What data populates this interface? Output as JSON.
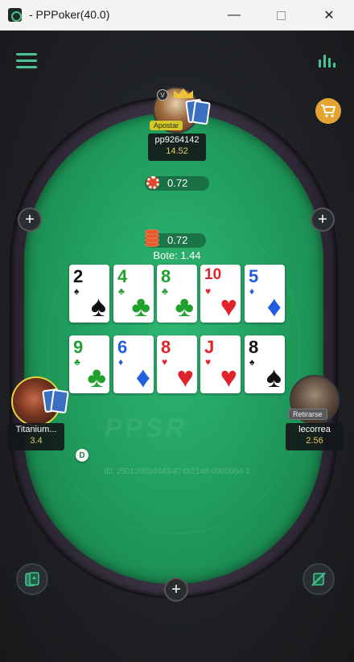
{
  "window": {
    "title": "- PPPoker(40.0)",
    "minimize": "—",
    "close": "✕"
  },
  "colors": {
    "accent": "#46c496",
    "felt": "#1f9a5b",
    "stack_text": "#e6c75c",
    "bet_tag": "#d6c829"
  },
  "toolbar": {
    "menu_icon": "hamburger-menu-icon",
    "stats_icon": "bar-chart-icon",
    "shop_icon": "shopping-cart-icon"
  },
  "players": {
    "top": {
      "name": "pp9264142",
      "stack": "14.52",
      "action": "Apostar",
      "bet": "0.72"
    },
    "left": {
      "name": "Titanium...",
      "stack": "3.4"
    },
    "right": {
      "name": "lecorrea",
      "stack": "2.56",
      "action": "Retirarse"
    }
  },
  "dealer_button": "D",
  "pot": {
    "chips": "0.72",
    "label": "Bote: 1.44"
  },
  "board": {
    "row1": [
      {
        "rank": "2",
        "suit": "♠",
        "cls": "suit-s"
      },
      {
        "rank": "4",
        "suit": "♣",
        "cls": "suit-c"
      },
      {
        "rank": "8",
        "suit": "♣",
        "cls": "suit-c"
      },
      {
        "rank": "10",
        "suit": "♥",
        "cls": "suit-h"
      },
      {
        "rank": "5",
        "suit": "♦",
        "cls": "suit-d"
      }
    ],
    "row2": [
      {
        "rank": "9",
        "suit": "♣",
        "cls": "suit-c"
      },
      {
        "rank": "6",
        "suit": "♦",
        "cls": "suit-d"
      },
      {
        "rank": "8",
        "suit": "♥",
        "cls": "suit-h"
      },
      {
        "rank": "J",
        "suit": "♥",
        "cls": "suit-h"
      },
      {
        "rank": "8",
        "suit": "♠",
        "cls": "suit-s"
      }
    ]
  },
  "table": {
    "watermark": "PPSR",
    "hand_id": "ID: 250126034643-87452148-0000064-1"
  },
  "seat_add_symbol": "+"
}
